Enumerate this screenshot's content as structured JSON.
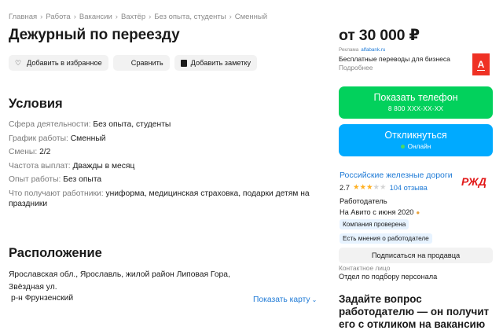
{
  "breadcrumbs": [
    "Главная",
    "Работа",
    "Вакансии",
    "Вахтёр",
    "Без опыта, студенты",
    "Сменный"
  ],
  "title": "Дежурный по переезду",
  "actions": {
    "favorite": "Добавить в избранное",
    "compare": "Сравнить",
    "note": "Добавить заметку"
  },
  "conditions": {
    "title": "Условия",
    "rows": [
      {
        "label": "Сфера деятельности:",
        "value": "Без опыта, студенты"
      },
      {
        "label": "График работы:",
        "value": "Сменный"
      },
      {
        "label": "Смены:",
        "value": "2/2"
      },
      {
        "label": "Частота выплат:",
        "value": "Дважды в месяц"
      },
      {
        "label": "Опыт работы:",
        "value": "Без опыта"
      },
      {
        "label": "Что получают работники:",
        "value": "униформа, медицинская страховка, подарки детям на праздники"
      }
    ]
  },
  "location": {
    "title": "Расположение",
    "address": "Ярославская обл., Ярославль, жилой район Липовая Гора, Звёздная ул.",
    "district": "р-н Фрунзенский",
    "show_map": "Показать карту"
  },
  "price": "от 30 000 ₽",
  "ad": {
    "label": "Реклама",
    "domain": "alfabank.ru",
    "text": "Бесплатные переводы для бизнеса",
    "more": "Подробнее",
    "logo_letter": "А"
  },
  "phone_button": {
    "label": "Показать телефон",
    "number": "8 800 XXX-XX-XX"
  },
  "respond_button": {
    "label": "Откликнуться",
    "status": "Онлайн"
  },
  "company": {
    "name": "Российские железные дороги",
    "rating": "2.7",
    "rating_value": 2.7,
    "reviews": "104 отзыва",
    "type": "Работодатель",
    "since": "На Авито с июня 2020",
    "badges": [
      "Компания проверена",
      "Есть мнения о работодателе"
    ],
    "logo_text": "РЖД"
  },
  "subscribe": "Подписаться на продавца",
  "contact": {
    "label": "Контактное лицо",
    "value": "Отдел по подбору персонала"
  },
  "ask": {
    "title": "Задайте вопрос работодателю — он получит его с откликом на вакансию"
  },
  "colors": {
    "green": "#02d15c",
    "blue": "#00aaff",
    "link": "#1e7ad6",
    "alfa_red": "#ef3124",
    "rzd_red": "#e21a1a"
  }
}
